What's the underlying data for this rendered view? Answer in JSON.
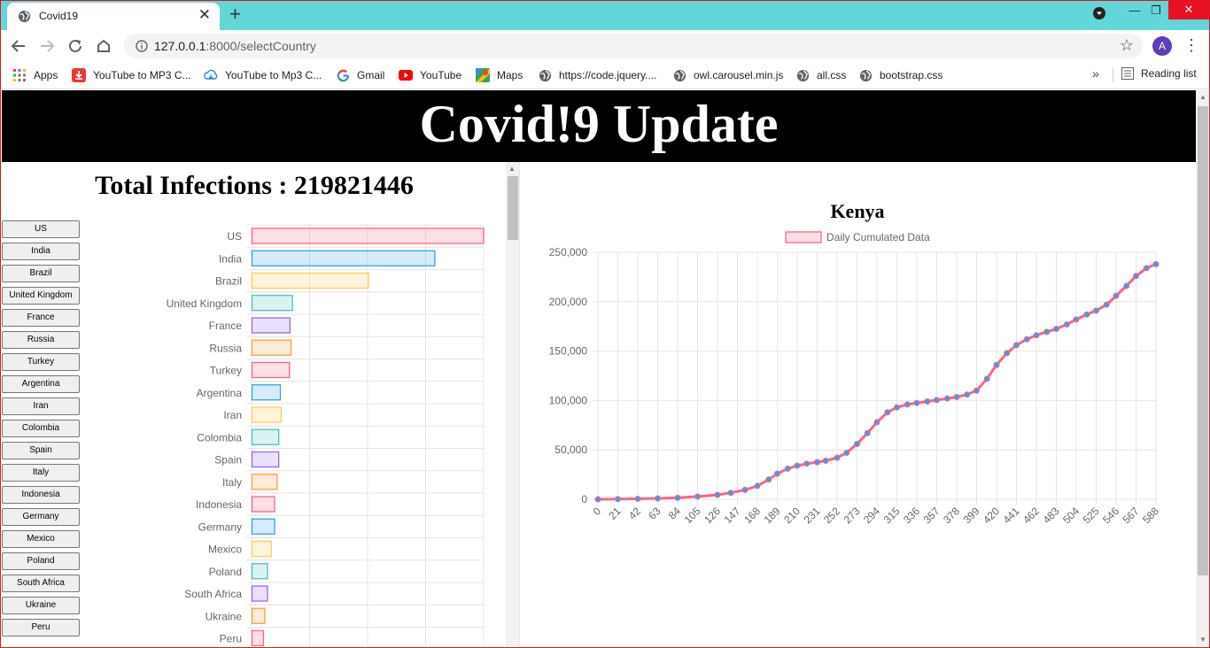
{
  "browser": {
    "tab_title": "Covid19",
    "url_host": "127.0.0.1",
    "url_rest": ":8000/selectCountry",
    "avatar_letter": "A",
    "bookmarks": [
      {
        "label": "Apps",
        "icon": "apps-grid-icon"
      },
      {
        "label": "YouTube to MP3 C...",
        "icon": "download-icon"
      },
      {
        "label": "YouTube to Mp3 C...",
        "icon": "cloud-download-icon"
      },
      {
        "label": "Gmail",
        "icon": "google-icon"
      },
      {
        "label": "YouTube",
        "icon": "youtube-icon"
      },
      {
        "label": "Maps",
        "icon": "maps-icon"
      },
      {
        "label": "https://code.jquery....",
        "icon": "globe-icon"
      },
      {
        "label": "owl.carousel.min.js",
        "icon": "globe-icon"
      },
      {
        "label": "all.css",
        "icon": "globe-icon"
      },
      {
        "label": "bootstrap.css",
        "icon": "globe-icon"
      }
    ],
    "reading_list": "Reading list"
  },
  "page": {
    "header": "Covid!9 Update",
    "total_infections": "Total Infections : 219821446"
  },
  "country_buttons": [
    "US",
    "India",
    "Brazil",
    "United Kingdom",
    "France",
    "Russia",
    "Turkey",
    "Argentina",
    "Iran",
    "Colombia",
    "Spain",
    "Italy",
    "Indonesia",
    "Germany",
    "Mexico",
    "Poland",
    "South Africa",
    "Ukraine",
    "Peru"
  ],
  "colors": {
    "pink": "#ff6384",
    "blue": "#36a2eb",
    "yellow": "#ffcd56",
    "teal": "#4bc0c0",
    "purple": "#9966ff",
    "orange": "#ff9f40",
    "line_border": "#ff6384",
    "point_fill": "#36a2eb"
  },
  "chart_data": [
    {
      "type": "bar",
      "orientation": "horizontal",
      "categories": [
        "US",
        "India",
        "Brazil",
        "United Kingdom",
        "France",
        "Russia",
        "Turkey",
        "Argentina",
        "Iran",
        "Colombia",
        "Spain",
        "Italy",
        "Indonesia",
        "Germany",
        "Mexico",
        "Poland",
        "South Africa",
        "Ukraine",
        "Peru"
      ],
      "values": [
        42300000,
        33400000,
        21300000,
        7450000,
        7000000,
        7200000,
        6900000,
        5250000,
        5400000,
        4950000,
        4950000,
        4650000,
        4200000,
        4200000,
        3600000,
        2900000,
        2900000,
        2400000,
        2170000
      ],
      "xlim": [
        0,
        42300000
      ],
      "grid": true,
      "legend": "none"
    },
    {
      "type": "line",
      "title": "Kenya",
      "series": [
        {
          "name": "Daily Cumulated Data"
        }
      ],
      "legend": "top",
      "x_ticks": [
        0,
        21,
        42,
        63,
        84,
        105,
        126,
        147,
        168,
        189,
        210,
        231,
        252,
        273,
        294,
        315,
        336,
        357,
        378,
        399,
        420,
        441,
        462,
        483,
        504,
        525,
        546,
        567,
        588
      ],
      "y_ticks": [
        0,
        50000,
        100000,
        150000,
        200000,
        250000
      ],
      "y_tick_labels": [
        "0",
        "50,000",
        "100,000",
        "150,000",
        "200,000",
        "250,000"
      ],
      "xlim": [
        0,
        588
      ],
      "ylim": [
        0,
        250000
      ],
      "x": [
        0,
        21,
        42,
        63,
        84,
        105,
        126,
        140,
        155,
        168,
        180,
        189,
        200,
        210,
        220,
        231,
        240,
        252,
        262,
        273,
        284,
        294,
        305,
        315,
        326,
        336,
        347,
        357,
        368,
        378,
        389,
        399,
        410,
        420,
        431,
        441,
        452,
        462,
        473,
        483,
        494,
        504,
        515,
        525,
        536,
        546,
        557,
        567,
        578,
        588
      ],
      "y": [
        0,
        200,
        500,
        900,
        1500,
        2800,
        4500,
        6500,
        9500,
        13500,
        20000,
        26000,
        31000,
        34000,
        36000,
        37500,
        39000,
        42000,
        47000,
        56000,
        67000,
        78000,
        88000,
        93000,
        96000,
        97500,
        99000,
        100500,
        102000,
        103500,
        106000,
        110000,
        122000,
        136000,
        148000,
        156000,
        162000,
        166000,
        169500,
        172500,
        177000,
        182000,
        187000,
        191000,
        197000,
        206000,
        216000,
        226000,
        234000,
        238000
      ],
      "grid": true
    }
  ]
}
